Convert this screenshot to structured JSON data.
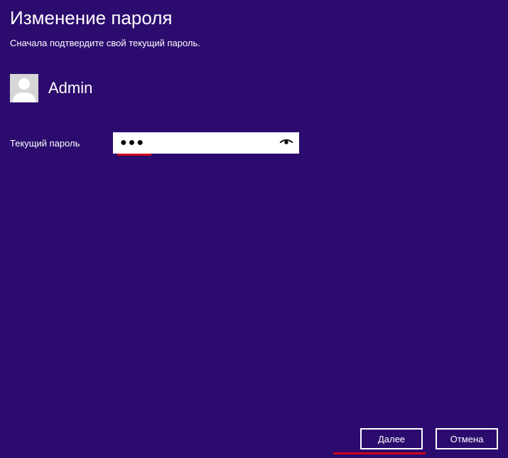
{
  "header": {
    "title": "Изменение пароля",
    "subtitle": "Сначала подтвердите свой текущий пароль."
  },
  "user": {
    "name": "Admin"
  },
  "form": {
    "current_password_label": "Текущий пароль",
    "current_password_value": "●●●"
  },
  "buttons": {
    "next": "Далее",
    "cancel": "Отмена"
  },
  "colors": {
    "background": "#2b0c6e",
    "annotation": "#d0021b"
  }
}
